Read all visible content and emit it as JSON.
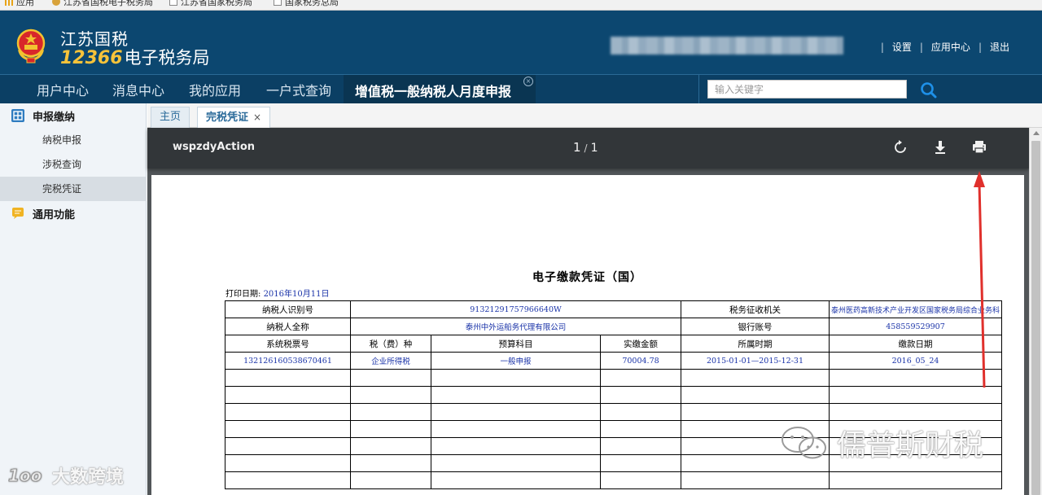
{
  "bookmarks": [
    {
      "label": "应用",
      "color": "#e8a317"
    },
    {
      "label": "江苏省国税电子税务局",
      "color": "#d8a23a"
    },
    {
      "label": "江苏省国家税务局",
      "color": "#ffffff"
    },
    {
      "label": "国家税务总局",
      "color": "#ffffff"
    }
  ],
  "header": {
    "brand_line1": "江苏国税",
    "brand_number": "12366",
    "brand_line2": "电子税务局",
    "links": [
      "设置",
      "应用中心",
      "退出"
    ],
    "colors": {
      "bg": "#0c4770",
      "nav": "#0b3f64",
      "accent": "#f7c33a"
    }
  },
  "nav": {
    "items": [
      "用户中心",
      "消息中心",
      "我的应用",
      "一户式查询"
    ],
    "active": "增值税一般纳税人月度申报",
    "search_placeholder": "输入关键字",
    "search_icon": "search-icon"
  },
  "sidebar": {
    "section1": "申报缴纳",
    "items": [
      "纳税申报",
      "涉税查询",
      "完税凭证"
    ],
    "active_item": "完税凭证",
    "section2": "通用功能"
  },
  "tabs": {
    "home": "主页",
    "current": "完税凭证",
    "close": "×"
  },
  "pdf": {
    "title": "wspzdyAction",
    "page_current": "1",
    "page_sep": "/",
    "page_total": "1",
    "buttons": [
      "rotate-icon",
      "download-icon",
      "print-icon"
    ]
  },
  "document": {
    "title": "电子缴款凭证（国）",
    "print_date_label": "打印日期:",
    "print_date": "2016年10月11日",
    "row1": {
      "label1": "纳税人识别号",
      "value1": "91321291757966640W",
      "label2": "税务征收机关",
      "value2": "泰州医药高新技术产业开发区国家税务局综合业务科"
    },
    "row2": {
      "label1": "纳税人全称",
      "value1": "泰州中外运船务代理有限公司",
      "label2": "银行账号",
      "value2": "458559529907"
    },
    "columns": [
      "系统税票号",
      "税（费）种",
      "预算科目",
      "实缴金额",
      "所属时期",
      "缴款日期"
    ],
    "rows": [
      [
        "132126160538670461",
        "企业所得税",
        "一般申报",
        "70004.78",
        "2015-01-01—2015-12-31",
        "2016_05_24"
      ]
    ]
  },
  "watermarks": {
    "left": "大数跨境",
    "right": "儒普斯财税"
  }
}
